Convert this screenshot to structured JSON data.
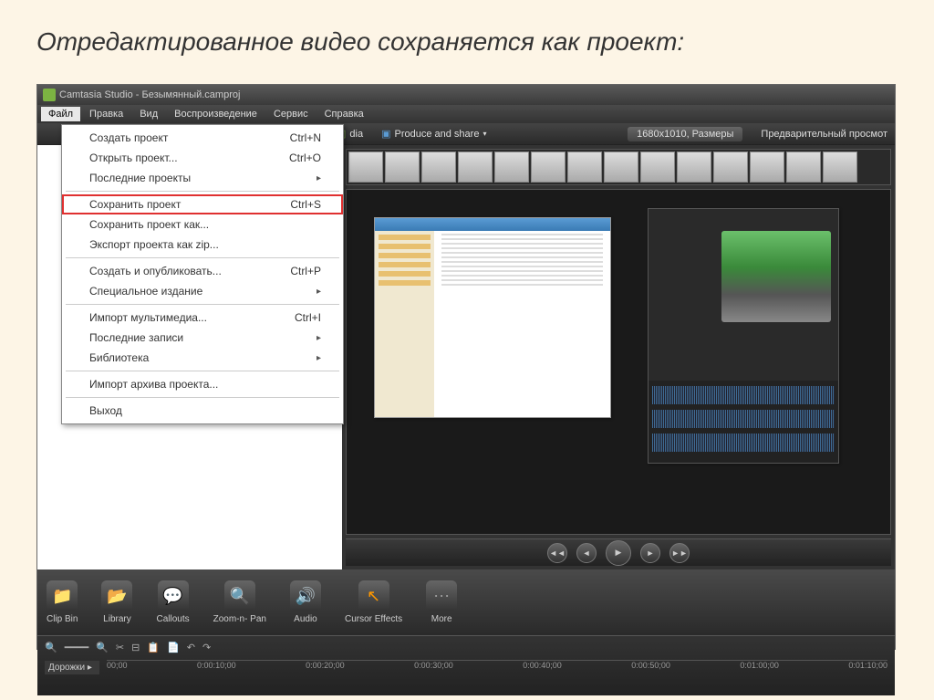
{
  "slide_title": "Отредактированное видео сохраняется как проект:",
  "titlebar": "Camtasia Studio - Безымянный.camproj",
  "menubar": [
    "Файл",
    "Правка",
    "Вид",
    "Воспроизведение",
    "Сервис",
    "Справка"
  ],
  "toolbar": {
    "btn_media": "dia",
    "btn_produce": "Produce and share",
    "dims": "1680x1010, Размеры",
    "preview_label": "Предварительный просмот"
  },
  "file_menu": [
    {
      "label": "Создать проект",
      "shortcut": "Ctrl+N",
      "sub": false
    },
    {
      "label": "Открыть проект...",
      "shortcut": "Ctrl+O",
      "sub": false
    },
    {
      "label": "Последние проекты",
      "shortcut": "",
      "sub": true
    },
    {
      "sep": true
    },
    {
      "label": "Сохранить проект",
      "shortcut": "Ctrl+S",
      "sub": false,
      "hl": true
    },
    {
      "label": "Сохранить проект как...",
      "shortcut": "",
      "sub": false
    },
    {
      "label": "Экспорт проекта как zip...",
      "shortcut": "",
      "sub": false
    },
    {
      "sep": true
    },
    {
      "label": "Создать и опубликовать...",
      "shortcut": "Ctrl+P",
      "sub": false
    },
    {
      "label": "Специальное издание",
      "shortcut": "",
      "sub": true
    },
    {
      "sep": true
    },
    {
      "label": "Импорт мультимедиа...",
      "shortcut": "Ctrl+I",
      "sub": false
    },
    {
      "label": "Последние записи",
      "shortcut": "",
      "sub": true
    },
    {
      "label": "Библиотека",
      "shortcut": "",
      "sub": true
    },
    {
      "sep": true
    },
    {
      "label": "Импорт архива проекта...",
      "shortcut": "",
      "sub": false
    },
    {
      "sep": true
    },
    {
      "label": "Выход",
      "shortcut": "",
      "sub": false
    }
  ],
  "tools": [
    {
      "label": "Clip Bin",
      "color": "#7cb342"
    },
    {
      "label": "Library",
      "color": "#7cb342"
    },
    {
      "label": "Callouts",
      "color": "#4a8ac4"
    },
    {
      "label": "Zoom-n-\nPan",
      "color": "#aaa"
    },
    {
      "label": "Audio",
      "color": "#ff9800"
    },
    {
      "label": "Cursor\nEffects",
      "color": "#ff9800"
    },
    {
      "label": "More",
      "color": "#999"
    }
  ],
  "timeline": {
    "track_label": "Дорожки",
    "ticks": [
      "00;00",
      "0:00:10;00",
      "0:00:20;00",
      "0:00:30;00",
      "0:00:40;00",
      "0:00:50;00",
      "0:01:00;00",
      "0:01:10;00"
    ]
  }
}
